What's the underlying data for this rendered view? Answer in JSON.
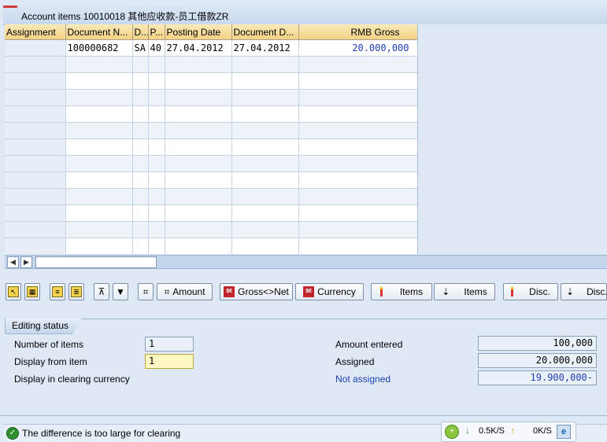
{
  "list": {
    "title": "Account items 10010018 其他应收款-员工借款ZR",
    "columns": [
      "Assignment",
      "Document N...",
      "D...",
      "P...",
      "Posting Date",
      "Document D...",
      "RMB Gross"
    ],
    "rows": [
      [
        "",
        "100000682",
        "SA",
        "40",
        "27.04.2012",
        "27.04.2012",
        "20.000,000"
      ]
    ]
  },
  "toolbar": {
    "amount_label": "Amount",
    "gross_net_label": "Gross<>Net",
    "currency_label": "Currency",
    "items_label_1": "Items",
    "items_label_2": "Items",
    "disc_label_1": "Disc.",
    "disc_label_2": "Disc."
  },
  "editing": {
    "tab_label": "Editing status",
    "number_of_items_label": "Number of items",
    "number_of_items_value": "1",
    "display_from_item_label": "Display from item",
    "display_from_item_value": "1",
    "display_clearing_label": "Display in clearing currency",
    "amount_entered_label": "Amount entered",
    "amount_entered_value": "100,000",
    "assigned_label": "Assigned",
    "assigned_value": "20.000,000",
    "not_assigned_label": "Not assigned",
    "not_assigned_value": "19.900,000-"
  },
  "status": {
    "message": "The difference is too large for clearing"
  },
  "network": {
    "down": "0.5K/S",
    "up": "0K/S"
  },
  "colors": {
    "link_blue": "#1f3fb5",
    "header_orange": "#f3d184",
    "background": "#dfe9f5"
  }
}
